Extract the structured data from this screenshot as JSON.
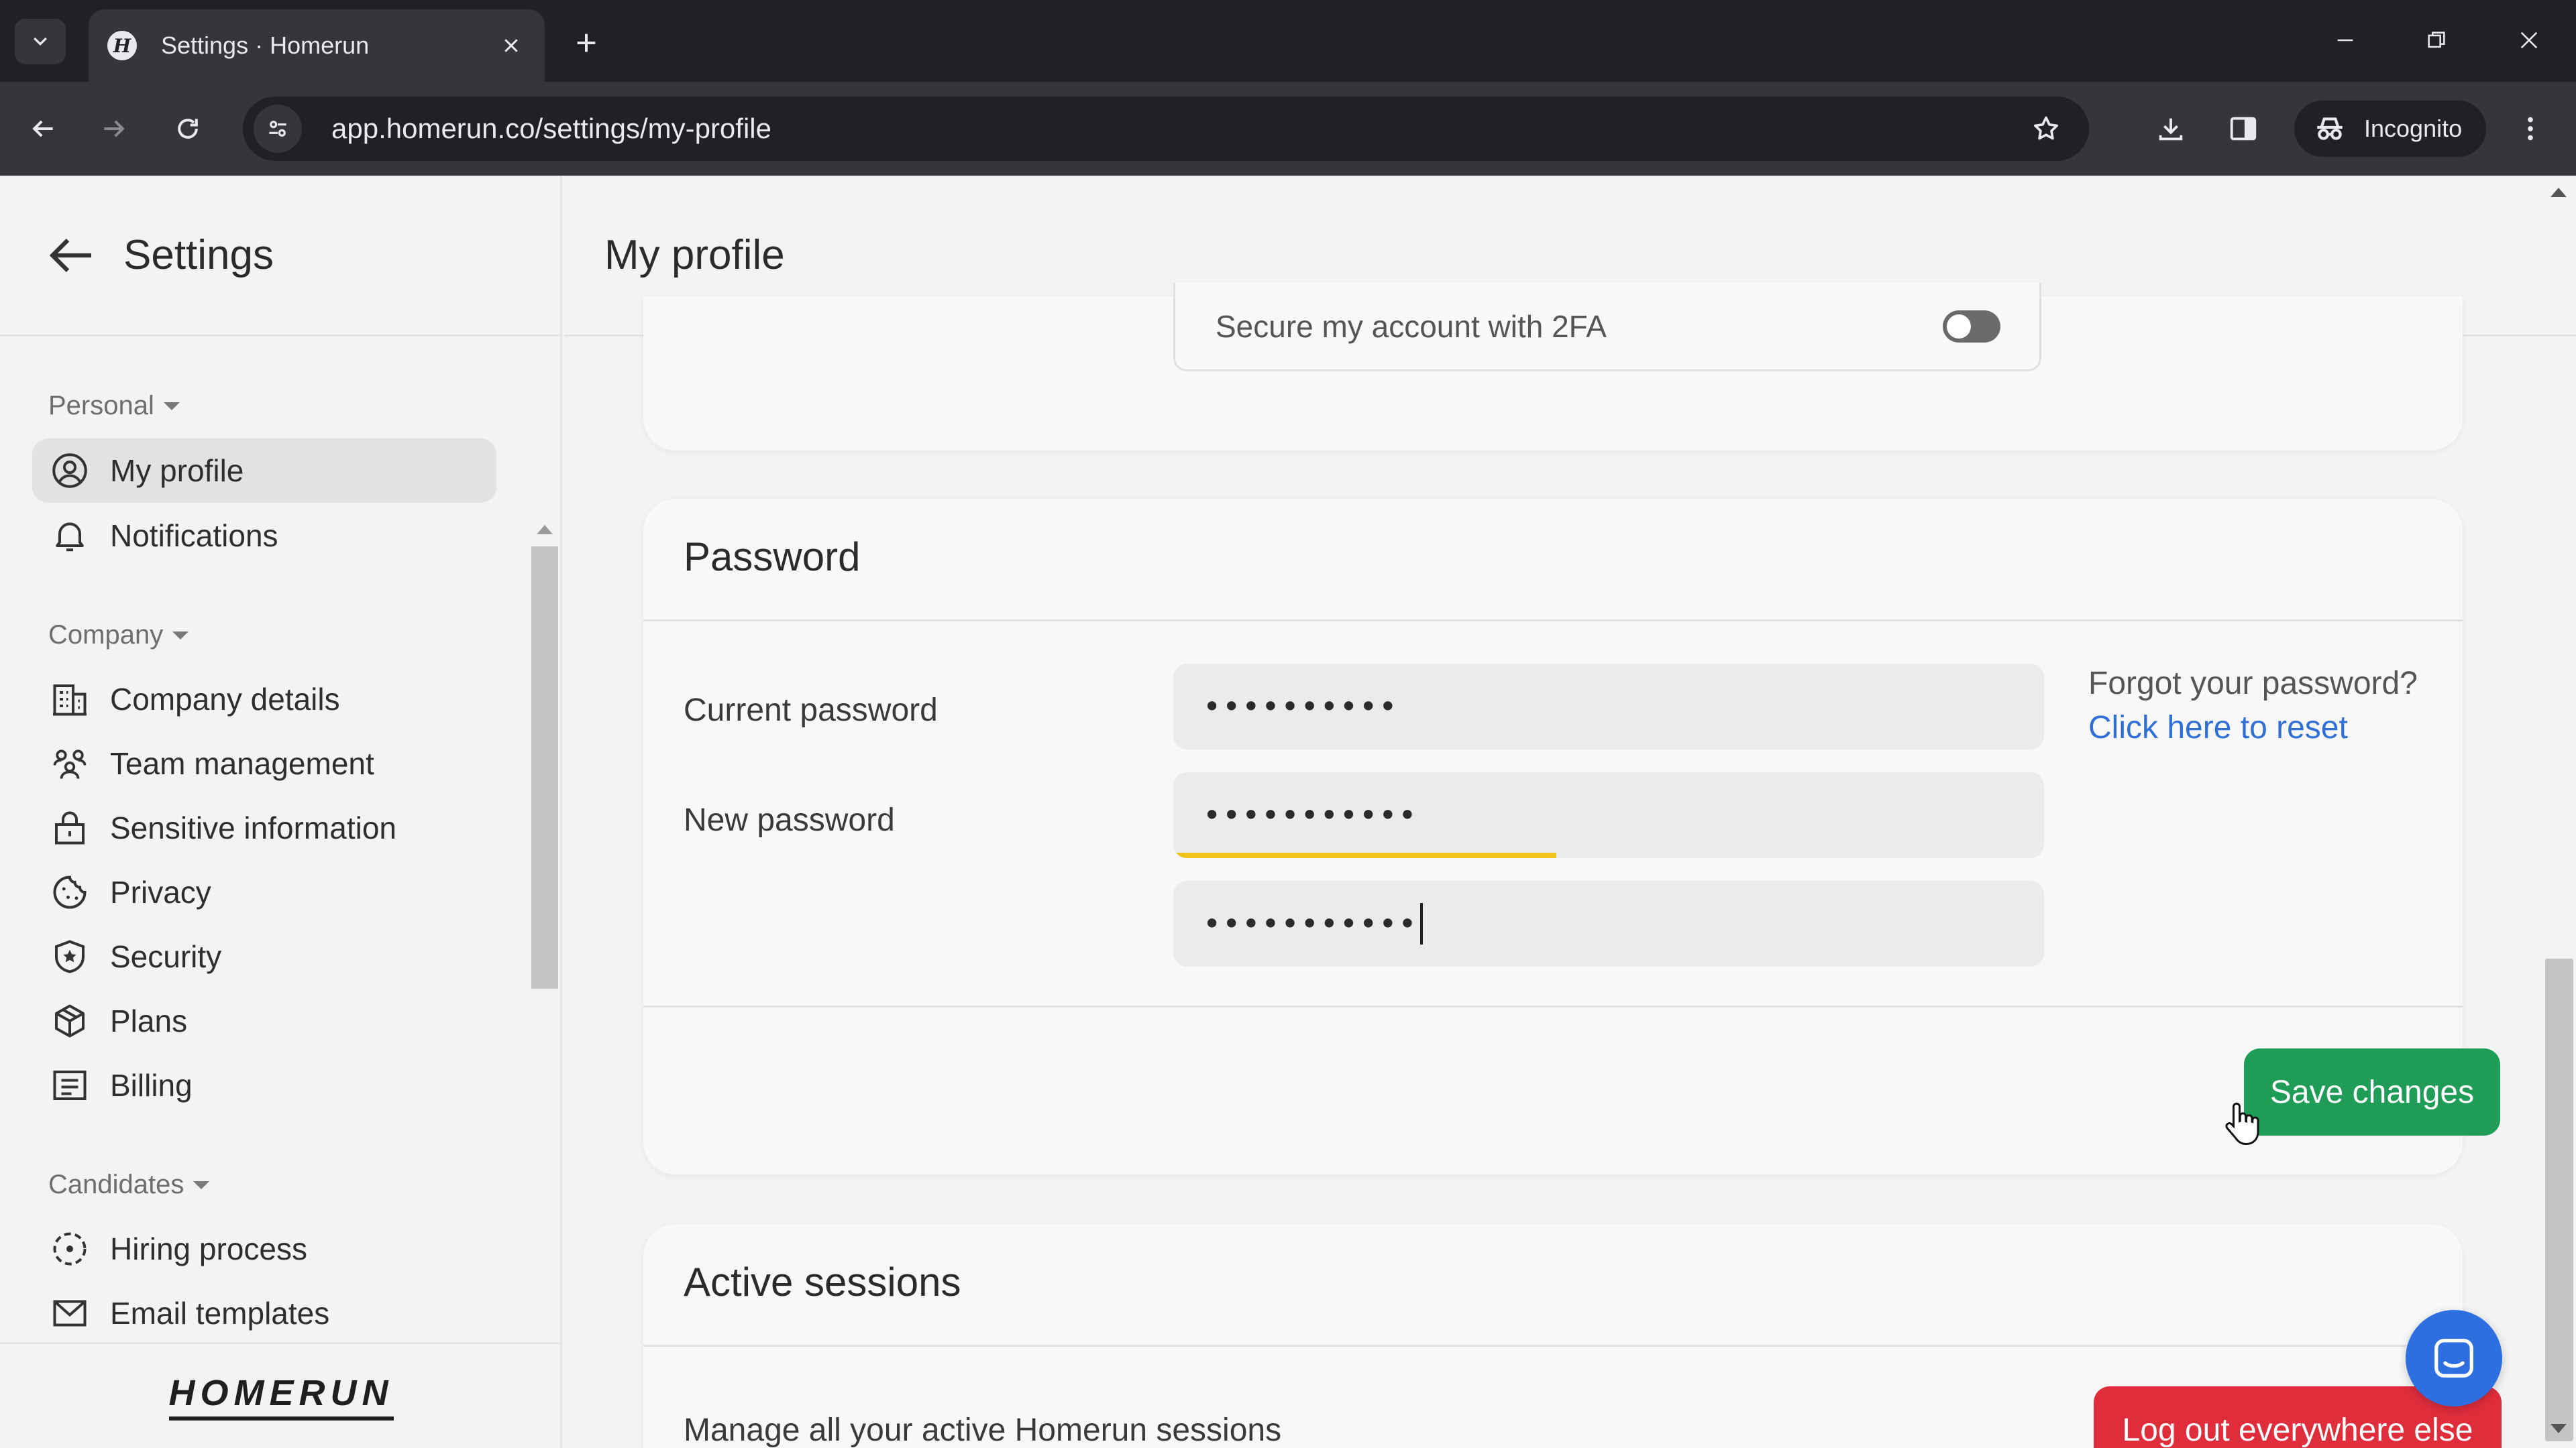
{
  "browser": {
    "tab_title": "Settings · Homerun",
    "url": "app.homerun.co/settings/my-profile",
    "incognito_label": "Incognito"
  },
  "sidebar": {
    "title": "Settings",
    "sections": [
      {
        "label": "Personal",
        "items": [
          {
            "label": "My profile",
            "icon": "user-circle-icon",
            "active": true
          },
          {
            "label": "Notifications",
            "icon": "bell-icon"
          }
        ]
      },
      {
        "label": "Company",
        "items": [
          {
            "label": "Company details",
            "icon": "building-icon"
          },
          {
            "label": "Team management",
            "icon": "team-icon"
          },
          {
            "label": "Sensitive information",
            "icon": "lock-icon"
          },
          {
            "label": "Privacy",
            "icon": "cookie-icon"
          },
          {
            "label": "Security",
            "icon": "shield-icon"
          },
          {
            "label": "Plans",
            "icon": "box-icon"
          },
          {
            "label": "Billing",
            "icon": "receipt-icon"
          }
        ]
      },
      {
        "label": "Candidates",
        "items": [
          {
            "label": "Hiring process",
            "icon": "process-icon"
          },
          {
            "label": "Email templates",
            "icon": "mail-icon"
          }
        ]
      }
    ],
    "logo": "HOMERUN"
  },
  "main": {
    "title": "My profile",
    "twofa": {
      "label": "Secure my account with 2FA",
      "enabled": false
    },
    "password": {
      "title": "Password",
      "current_label": "Current password",
      "current_value": "••••••••••",
      "new_label": "New password",
      "new_value": "•••••••••••",
      "confirm_value": "•••••••••••",
      "strength": 0.44,
      "forgot_text": "Forgot your password?",
      "reset_link": "Click here to reset",
      "save_label": "Save changes"
    },
    "sessions": {
      "title": "Active sessions",
      "description": "Manage all your active Homerun sessions",
      "logout_label": "Log out everywhere else"
    }
  },
  "colors": {
    "accent_green": "#1f9d57",
    "danger_red": "#e02d3c",
    "link_blue": "#2f6fd6",
    "strength_yellow": "#f0c419",
    "chat_blue": "#2d6fe0"
  }
}
